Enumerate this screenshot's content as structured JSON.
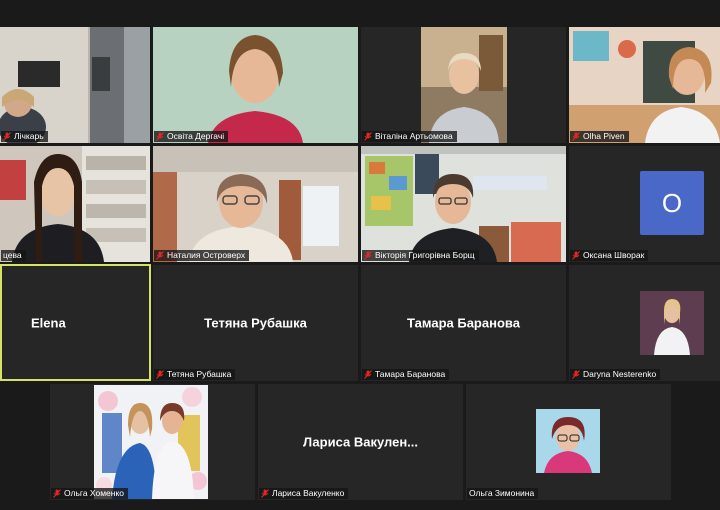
{
  "meeting": {
    "tiles": [
      {
        "name": "Лічкарь",
        "centerName": ""
      },
      {
        "name": "Освіта Дергачі",
        "centerName": ""
      },
      {
        "name": "Віталіна Артьомова",
        "centerName": ""
      },
      {
        "name": "Olha Piven",
        "centerName": ""
      },
      {
        "name": "цева",
        "centerName": ""
      },
      {
        "name": "Наталия Островерх",
        "centerName": ""
      },
      {
        "name": "Вікторія Григорівна Борщ",
        "centerName": ""
      },
      {
        "name": "Оксана Шворак",
        "centerName": "",
        "initial": "O"
      },
      {
        "name": "",
        "centerName": "Elena"
      },
      {
        "name": "Тетяна Рубашка",
        "centerName": "Тетяна Рубашка"
      },
      {
        "name": "Тамара Баранова",
        "centerName": "Тамара Баранова"
      },
      {
        "name": "Daryna Nesterenko",
        "centerName": ""
      },
      {
        "name": "Ольга Хоменко",
        "centerName": ""
      },
      {
        "name": "Лариса Вакуленко",
        "centerName": "Лариса  Вакулен..."
      },
      {
        "name": "Ольга Зимонина",
        "centerName": ""
      }
    ],
    "colors": {
      "background": "#1a1a1a",
      "tile": "#262626",
      "activeSpeakerBorder": "#d6e261",
      "avatarInitial": "#4a68c8",
      "mutedMic": "#e02828"
    }
  }
}
